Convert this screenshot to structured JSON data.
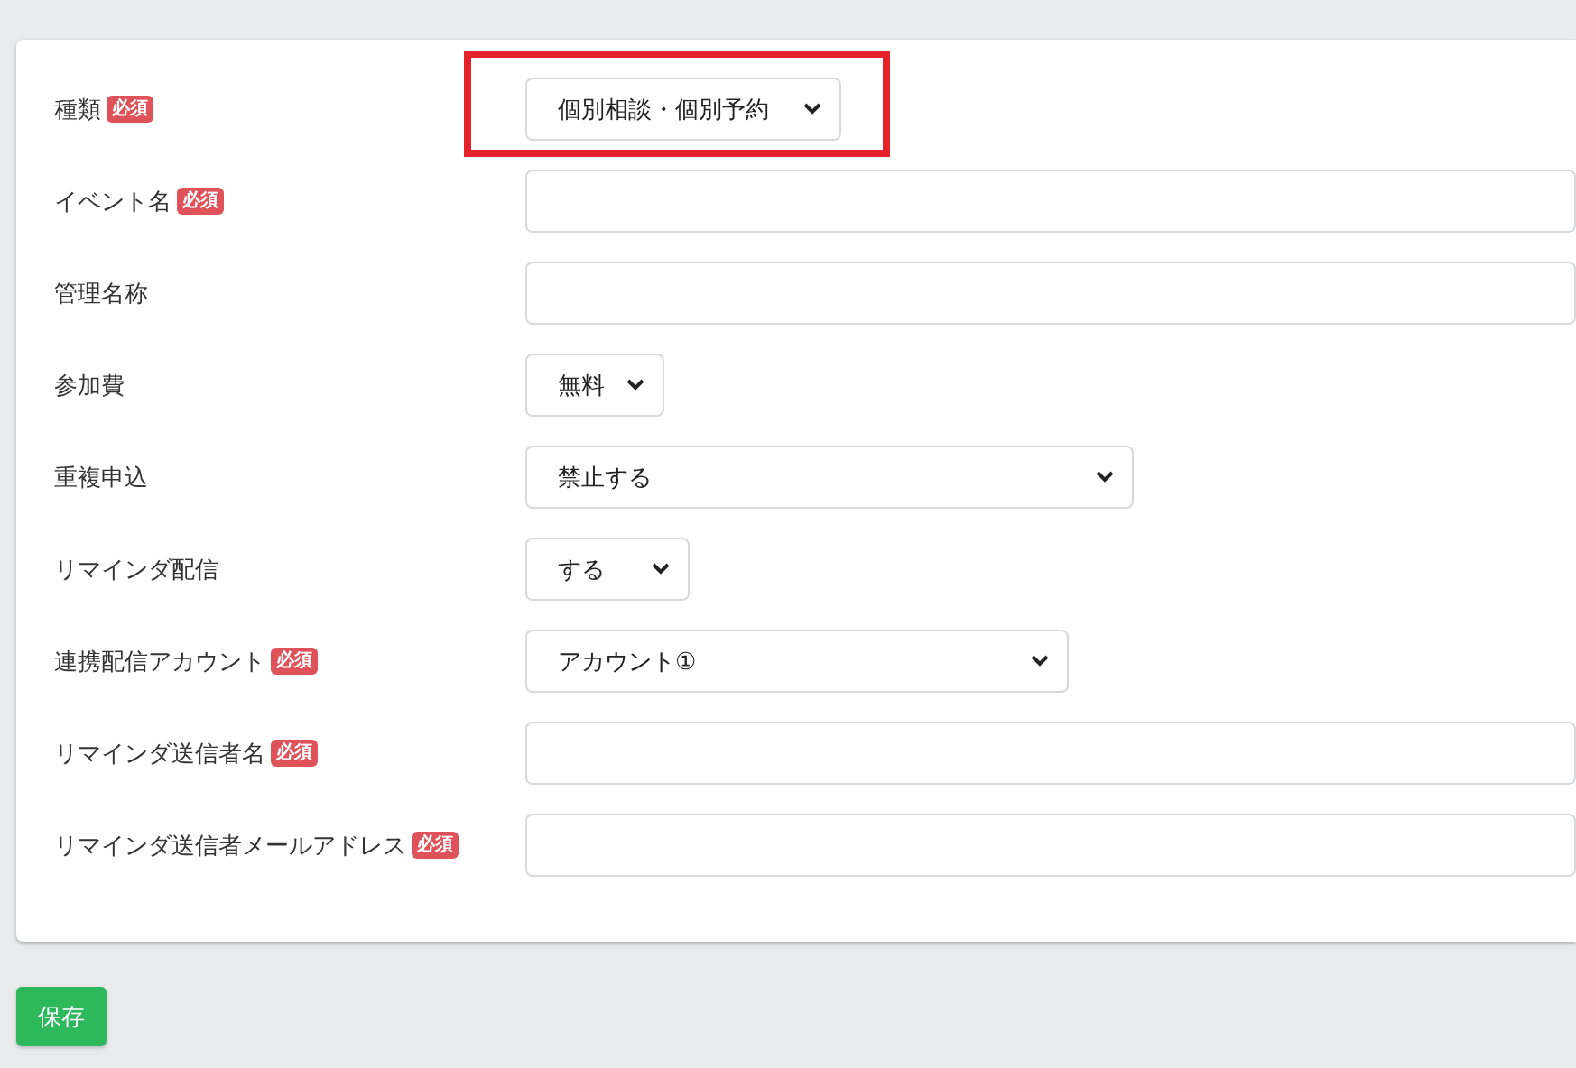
{
  "form": {
    "rows": [
      {
        "label": "種類",
        "required": true,
        "required_label": "必須",
        "kind": "select",
        "value": "個別相談・個別予約",
        "highlighted": true
      },
      {
        "label": "イベント名",
        "required": true,
        "required_label": "必須",
        "kind": "text"
      },
      {
        "label": "管理名称",
        "required": false,
        "kind": "text"
      },
      {
        "label": "参加費",
        "required": false,
        "kind": "select",
        "value": "無料"
      },
      {
        "label": "重複申込",
        "required": false,
        "kind": "select",
        "value": "禁止する"
      },
      {
        "label": "リマインダ配信",
        "required": false,
        "kind": "select",
        "value": "する"
      },
      {
        "label": "連携配信アカウント",
        "required": true,
        "required_label": "必須",
        "kind": "select",
        "value": "アカウント①"
      },
      {
        "label": "リマインダ送信者名",
        "required": true,
        "required_label": "必須",
        "kind": "text"
      },
      {
        "label": "リマインダ送信者メールアドレス",
        "required": true,
        "required_label": "必須",
        "kind": "text"
      }
    ]
  },
  "save_button": "保存"
}
